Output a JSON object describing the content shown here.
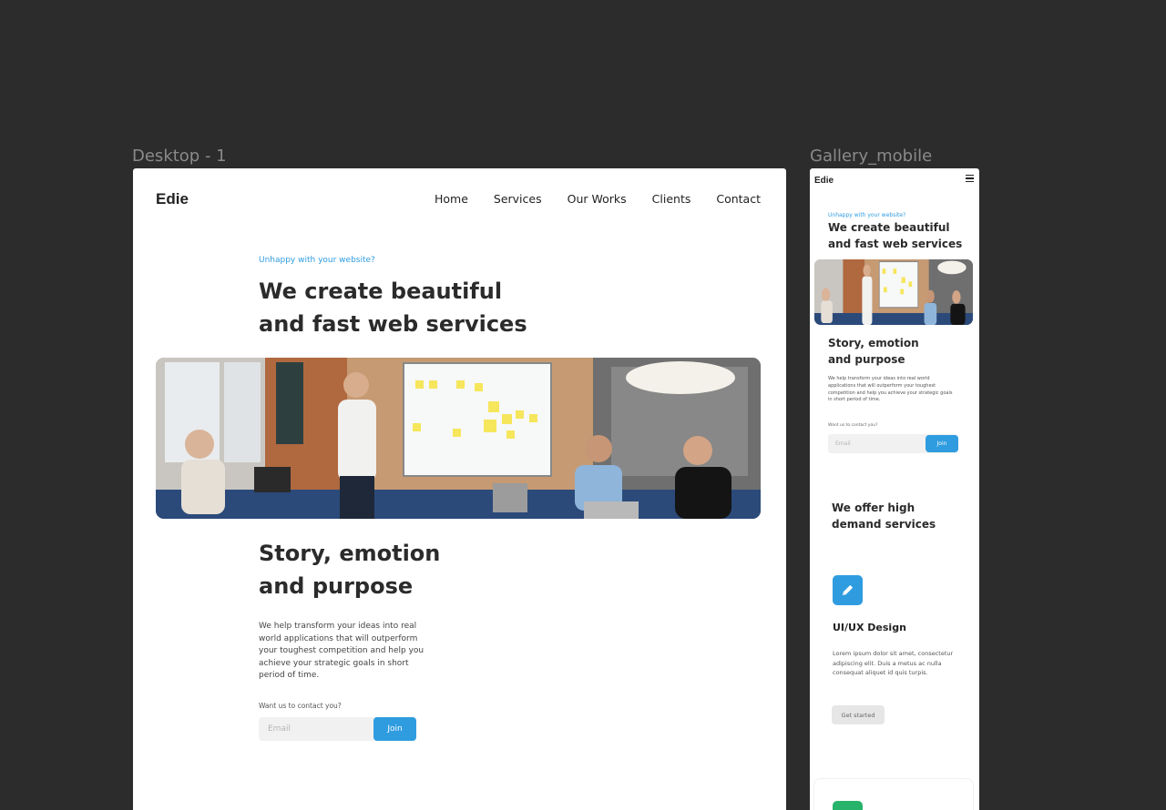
{
  "frames": {
    "desktop_label": "Desktop - 1",
    "mobile_label": "Gallery_mobile"
  },
  "brand": {
    "name": "Edie",
    "accent_color": "#2f9ce0",
    "secondary_accent": "#27b36a"
  },
  "nav": {
    "items": [
      "Home",
      "Services",
      "Our Works",
      "Clients",
      "Contact"
    ]
  },
  "hero": {
    "eyebrow": "Unhappy with your website?",
    "title": "We create beautiful and fast web services",
    "image_alt": "Team meeting in an office with a whiteboard"
  },
  "story": {
    "title": "Story, emotion and purpose",
    "text": "We help transform your ideas into real world applications that will outperform your toughest competition and help you achieve your strategic goals in short period of time.",
    "contact_prompt": "Want us to contact you?",
    "email_placeholder": "Email",
    "join_label": "Join"
  },
  "mobile": {
    "menu_icon": "hamburger-icon",
    "offer_title": "We offer high demand services",
    "service": {
      "icon": "pencil-icon",
      "title": "UI/UX Design",
      "text": "Lorem ipsum dolor sit amet, consectetur adipiscing elit. Duis a metus ac nulla consequat aliquet id quis turpis.",
      "button_label": "Get started"
    }
  }
}
